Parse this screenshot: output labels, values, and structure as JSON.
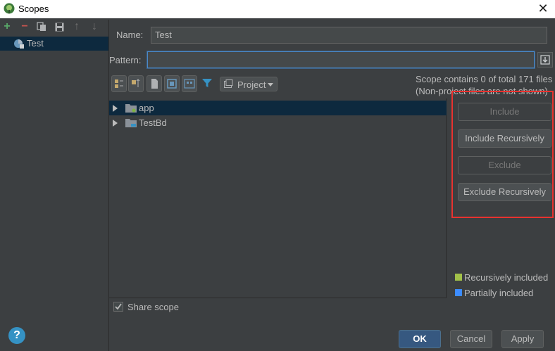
{
  "window": {
    "title": "Scopes",
    "close_glyph": "✕"
  },
  "left_toolbar": {
    "add_icon": "+",
    "remove_icon": "−",
    "copy_icon": "copy-icon",
    "save_icon": "save-icon",
    "move_up_icon": "↑",
    "move_down_icon": "↓"
  },
  "scopes": [
    {
      "label": "Test"
    }
  ],
  "form": {
    "name_label": "Name:",
    "name_value": "Test",
    "pattern_label": "Pattern:",
    "pattern_value": ""
  },
  "tree_toolbar": {
    "project_combo": "Project"
  },
  "scope_info": {
    "line1": "Scope contains 0 of total 171 files",
    "line2": "(Non-project files are not shown)"
  },
  "tree": [
    {
      "name": "app",
      "selected": true
    },
    {
      "name": "TestBd",
      "selected": false
    }
  ],
  "actions": {
    "include": "Include",
    "include_recursively": "Include Recursively",
    "exclude": "Exclude",
    "exclude_recursively": "Exclude Recursively"
  },
  "legend": {
    "recursive": {
      "label": "Recursively included",
      "color": "#a2c149"
    },
    "partial": {
      "label": "Partially included",
      "color": "#3d8cff"
    }
  },
  "share_scope": {
    "label": "Share scope",
    "checked": true
  },
  "footer": {
    "help": "?",
    "ok": "OK",
    "cancel": "Cancel",
    "apply": "Apply"
  },
  "colors": {
    "highlight_box": "#e8322f",
    "selection": "#0d293e",
    "accent": "#365880"
  }
}
